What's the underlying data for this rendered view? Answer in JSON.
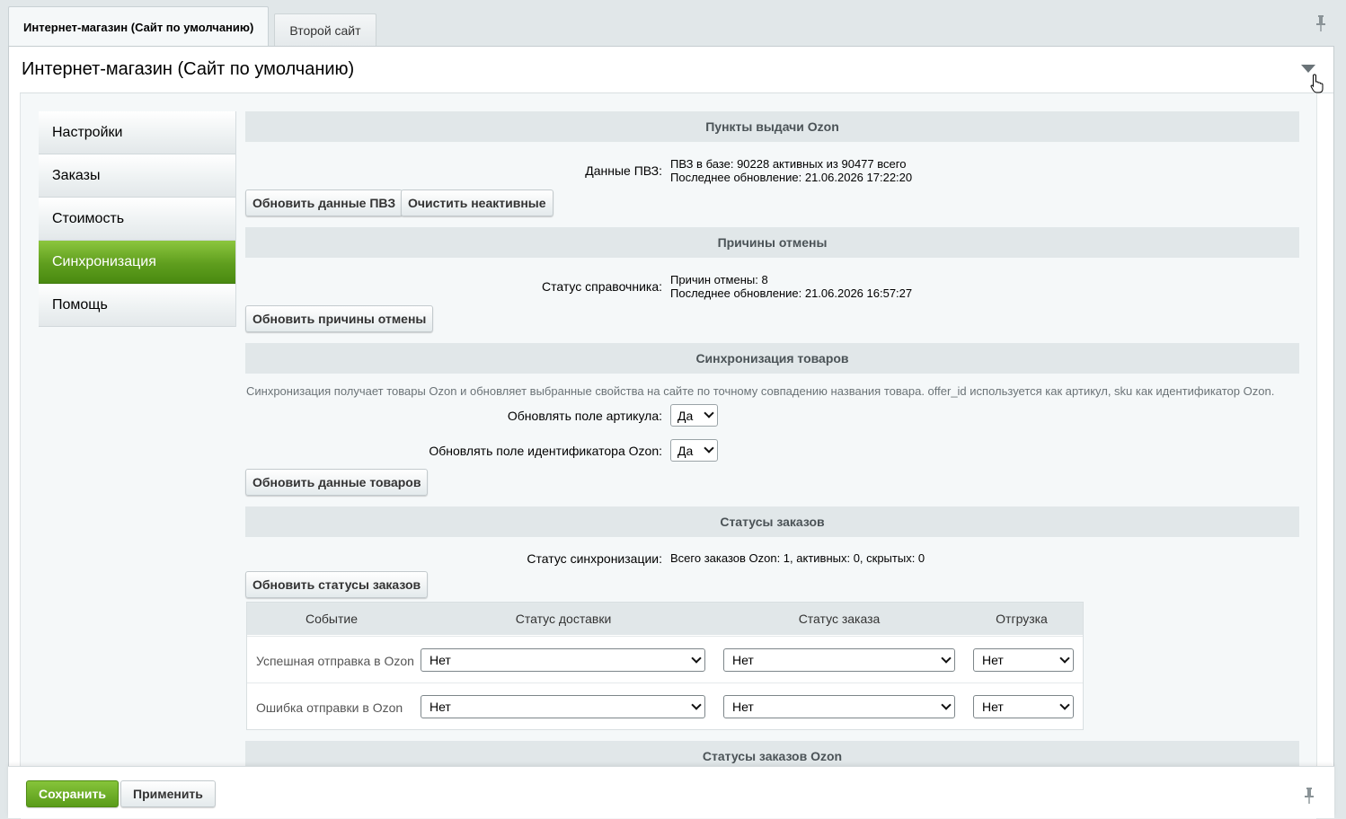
{
  "site_tabs": [
    {
      "label": "Интернет-магазин (Сайт по умолчанию)",
      "active": true
    },
    {
      "label": "Второй сайт",
      "active": false
    }
  ],
  "panel": {
    "title": "Интернет-магазин (Сайт по умолчанию)"
  },
  "menu": {
    "items": [
      {
        "label": "Настройки"
      },
      {
        "label": "Заказы"
      },
      {
        "label": "Стоимость"
      },
      {
        "label": "Синхронизация"
      },
      {
        "label": "Помощь"
      }
    ],
    "active_index": 3
  },
  "sections": {
    "pvz": {
      "title": "Пункты выдачи Ozon",
      "field_label": "Данные ПВЗ:",
      "line1": "ПВЗ в базе: 90228 активных из 90477 всего",
      "line2": "Последнее обновление: 21.06.2026 17:22:20",
      "btn_update": "Обновить данные ПВЗ",
      "btn_clear": "Очистить неактивные"
    },
    "cancel": {
      "title": "Причины отмены",
      "field_label": "Статус справочника:",
      "line1": "Причин отмены: 8",
      "line2": "Последнее обновление: 21.06.2026 16:57:27",
      "btn_update": "Обновить причины отмены"
    },
    "products": {
      "title": "Синхронизация товаров",
      "description": "Синхронизация получает товары Ozon и обновляет выбранные свойства на сайте по точному совпадению названия товара. offer_id используется как артикул, sku как идентификатор Ozon.",
      "article_label": "Обновлять поле артикула:",
      "article_value": "Да",
      "ozonid_label": "Обновлять поле идентификатора Ozon:",
      "ozonid_value": "Да",
      "btn_update": "Обновить данные товаров"
    },
    "order_statuses": {
      "title": "Статусы заказов",
      "field_label": "Статус синхронизации:",
      "value": "Всего заказов Ozon: 1, активных: 0, скрытых: 0",
      "btn_update": "Обновить статусы заказов",
      "table": {
        "headers": [
          "Событие",
          "Статус доставки",
          "Статус заказа",
          "Отгрузка"
        ],
        "rows": [
          {
            "event": "Успешная отправка в Ozon",
            "delivery": "Нет",
            "order": "Нет",
            "shipment": "Нет"
          },
          {
            "event": "Ошибка отправки в Ozon",
            "delivery": "Нет",
            "order": "Нет",
            "shipment": "Нет"
          }
        ]
      }
    },
    "ozon_order_statuses": {
      "title": "Статусы заказов Ozon"
    }
  },
  "footer": {
    "save": "Сохранить",
    "apply": "Применить"
  },
  "colors": {
    "accent_green": "#5f9e1e",
    "section_bg": "#e1e7e9"
  },
  "icons": {
    "pin": "pin-icon",
    "collapse": "collapse-arrow-icon",
    "cursor": "hand-cursor-icon"
  }
}
